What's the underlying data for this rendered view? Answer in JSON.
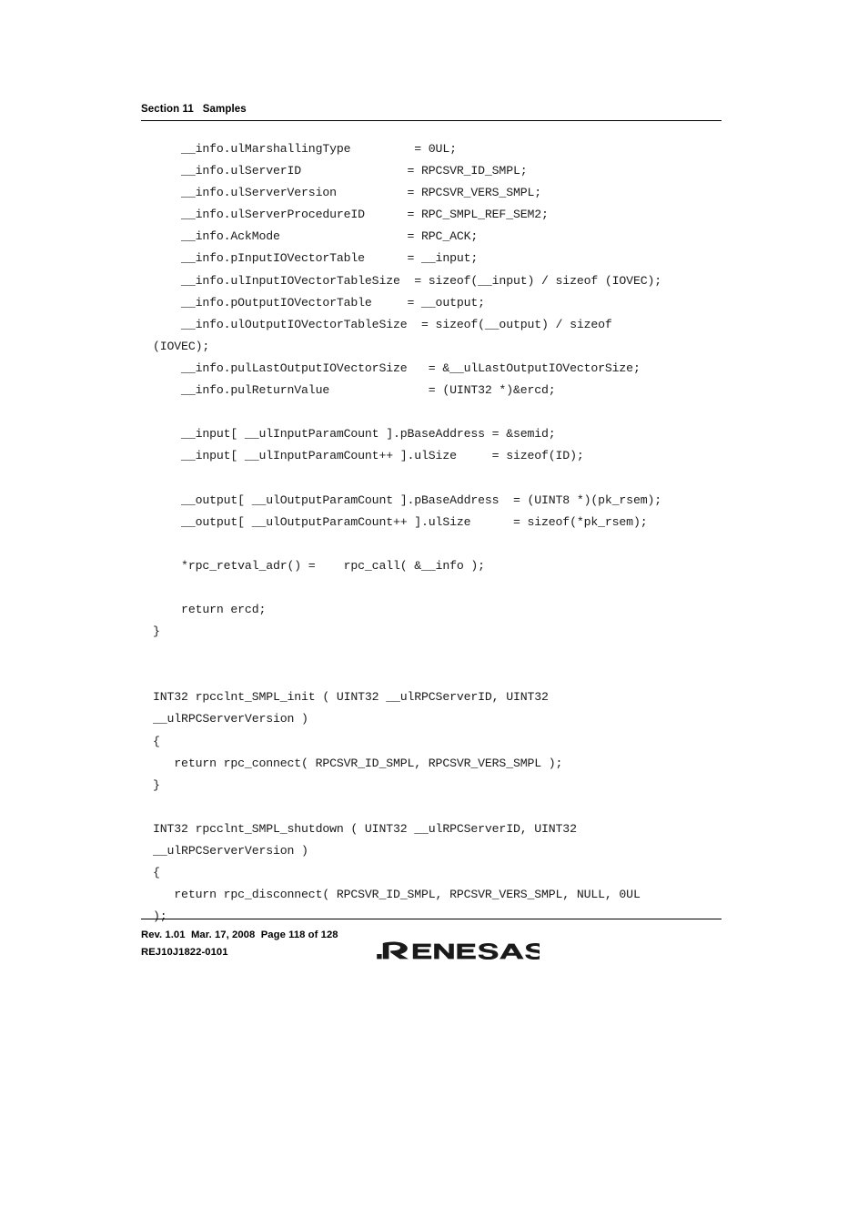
{
  "header": {
    "title": "Section 11   Samples"
  },
  "code": {
    "lines": [
      "    __info.ulMarshallingType         = 0UL;",
      "    __info.ulServerID               = RPCSVR_ID_SMPL;",
      "    __info.ulServerVersion          = RPCSVR_VERS_SMPL;",
      "    __info.ulServerProcedureID      = RPC_SMPL_REF_SEM2;",
      "    __info.AckMode                  = RPC_ACK;",
      "    __info.pInputIOVectorTable      = __input;",
      "    __info.ulInputIOVectorTableSize  = sizeof(__input) / sizeof (IOVEC);",
      "    __info.pOutputIOVectorTable     = __output;",
      "    __info.ulOutputIOVectorTableSize  = sizeof(__output) / sizeof",
      "(IOVEC);",
      "    __info.pulLastOutputIOVectorSize   = &__ulLastOutputIOVectorSize;",
      "    __info.pulReturnValue              = (UINT32 *)&ercd;",
      "",
      "    __input[ __ulInputParamCount ].pBaseAddress = &semid;",
      "    __input[ __ulInputParamCount++ ].ulSize     = sizeof(ID);",
      "",
      "    __output[ __ulOutputParamCount ].pBaseAddress  = (UINT8 *)(pk_rsem);",
      "    __output[ __ulOutputParamCount++ ].ulSize      = sizeof(*pk_rsem);",
      "",
      "    *rpc_retval_adr() =    rpc_call( &__info );",
      "",
      "    return ercd;",
      "}",
      "",
      "",
      "INT32 rpcclnt_SMPL_init ( UINT32 __ulRPCServerID, UINT32",
      "__ulRPCServerVersion )",
      "{",
      "   return rpc_connect( RPCSVR_ID_SMPL, RPCSVR_VERS_SMPL );",
      "}",
      "",
      "INT32 rpcclnt_SMPL_shutdown ( UINT32 __ulRPCServerID, UINT32",
      "__ulRPCServerVersion )",
      "{",
      "   return rpc_disconnect( RPCSVR_ID_SMPL, RPCSVR_VERS_SMPL, NULL, 0UL",
      ");"
    ]
  },
  "footer": {
    "revision_line": "Rev. 1.01  Mar. 17, 2008  Page 118 of 128",
    "document_number": "REJ10J1822-0101",
    "logo_text": "RENESAS"
  }
}
